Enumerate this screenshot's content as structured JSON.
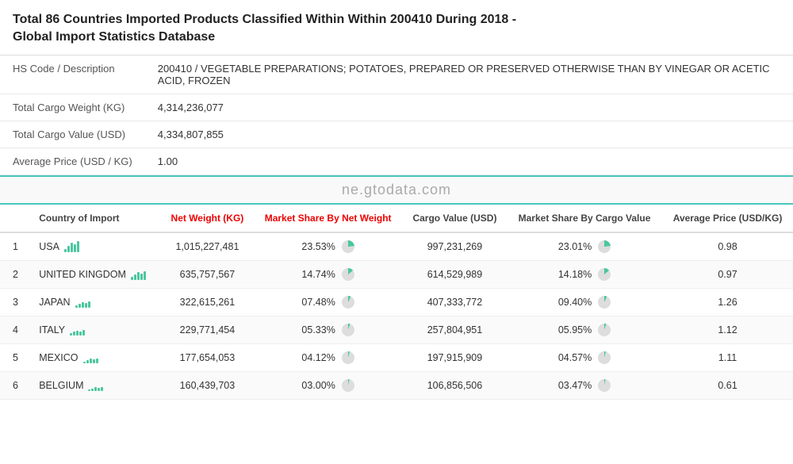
{
  "header": {
    "title_part1": "Total 86 Countries Imported Products Classified Within Within 200410 During 2018",
    "title_part2": " - Global Import Statistics Database"
  },
  "info_rows": [
    {
      "label": "HS Code / Description",
      "value": "200410 / VEGETABLE PREPARATIONS; POTATOES, PREPARED OR PRESERVED OTHERWISE THAN BY VINEGAR OR ACETIC ACID, FROZEN"
    },
    {
      "label": "Total Cargo Weight (KG)",
      "value": "4,314,236,077"
    },
    {
      "label": "Total Cargo Value (USD)",
      "value": "4,334,807,855"
    },
    {
      "label": "Average Price (USD / KG)",
      "value": "1.00"
    }
  ],
  "watermark": "ne.gtodata.com",
  "table": {
    "headers": [
      {
        "label": "",
        "class": "left"
      },
      {
        "label": "Country of Import",
        "class": "left"
      },
      {
        "label": "Net Weight (KG)",
        "class": "red"
      },
      {
        "label": "Market Share By Net Weight",
        "class": "red"
      },
      {
        "label": "Cargo Value (USD)",
        "class": ""
      },
      {
        "label": "Market Share By Cargo Value",
        "class": ""
      },
      {
        "label": "Average Price (USD/KG)",
        "class": ""
      }
    ],
    "rows": [
      {
        "num": "1",
        "country": "USA",
        "net_weight": "1,015,227,481",
        "market_share_weight": "23.53%",
        "cargo_value": "997,231,269",
        "market_share_cargo": "23.01%",
        "avg_price": "0.98",
        "pie_weight_class": "",
        "pie_cargo_class": ""
      },
      {
        "num": "2",
        "country": "UNITED KINGDOM",
        "net_weight": "635,757,567",
        "market_share_weight": "14.74%",
        "cargo_value": "614,529,989",
        "market_share_cargo": "14.18%",
        "avg_price": "0.97",
        "pie_weight_class": "p14",
        "pie_cargo_class": "p14"
      },
      {
        "num": "3",
        "country": "JAPAN",
        "net_weight": "322,615,261",
        "market_share_weight": "07.48%",
        "cargo_value": "407,333,772",
        "market_share_cargo": "09.40%",
        "avg_price": "1.26",
        "pie_weight_class": "p7",
        "pie_cargo_class": "p7"
      },
      {
        "num": "4",
        "country": "ITALY",
        "net_weight": "229,771,454",
        "market_share_weight": "05.33%",
        "cargo_value": "257,804,951",
        "market_share_cargo": "05.95%",
        "avg_price": "1.12",
        "pie_weight_class": "p5",
        "pie_cargo_class": "p5"
      },
      {
        "num": "5",
        "country": "MEXICO",
        "net_weight": "177,654,053",
        "market_share_weight": "04.12%",
        "cargo_value": "197,915,909",
        "market_share_cargo": "04.57%",
        "avg_price": "1.11",
        "pie_weight_class": "p4",
        "pie_cargo_class": "p4"
      },
      {
        "num": "6",
        "country": "BELGIUM",
        "net_weight": "160,439,703",
        "market_share_weight": "03.00%",
        "cargo_value": "106,856,506",
        "market_share_cargo": "03.47%",
        "avg_price": "0.61",
        "pie_weight_class": "p3",
        "pie_cargo_class": "p3"
      }
    ]
  }
}
